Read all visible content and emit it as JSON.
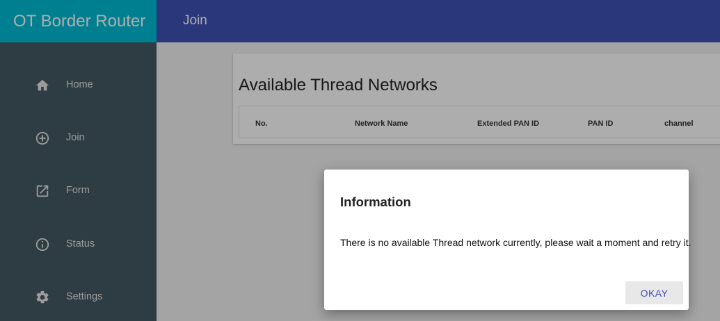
{
  "brand": "OT Border Router",
  "topbar": {
    "title": "Join"
  },
  "sidebar": {
    "items": [
      {
        "label": "Home",
        "icon": "home-icon"
      },
      {
        "label": "Join",
        "icon": "add-circle-icon"
      },
      {
        "label": "Form",
        "icon": "open-in-new-icon"
      },
      {
        "label": "Status",
        "icon": "info-icon"
      },
      {
        "label": "Settings",
        "icon": "gear-icon"
      }
    ]
  },
  "main": {
    "card_title": "Available Thread Networks",
    "table_headers": [
      "No.",
      "Network Name",
      "Extended PAN ID",
      "PAN ID",
      "channel"
    ]
  },
  "dialog": {
    "title": "Information",
    "message": "There is no available Thread network currently, please wait a moment and retry it.",
    "okay_label": "OKAY"
  },
  "colors": {
    "sidebar": "#455a64",
    "brand": "#00bcd4",
    "topbar": "#3f51b5",
    "accent": "#3f51b5"
  }
}
